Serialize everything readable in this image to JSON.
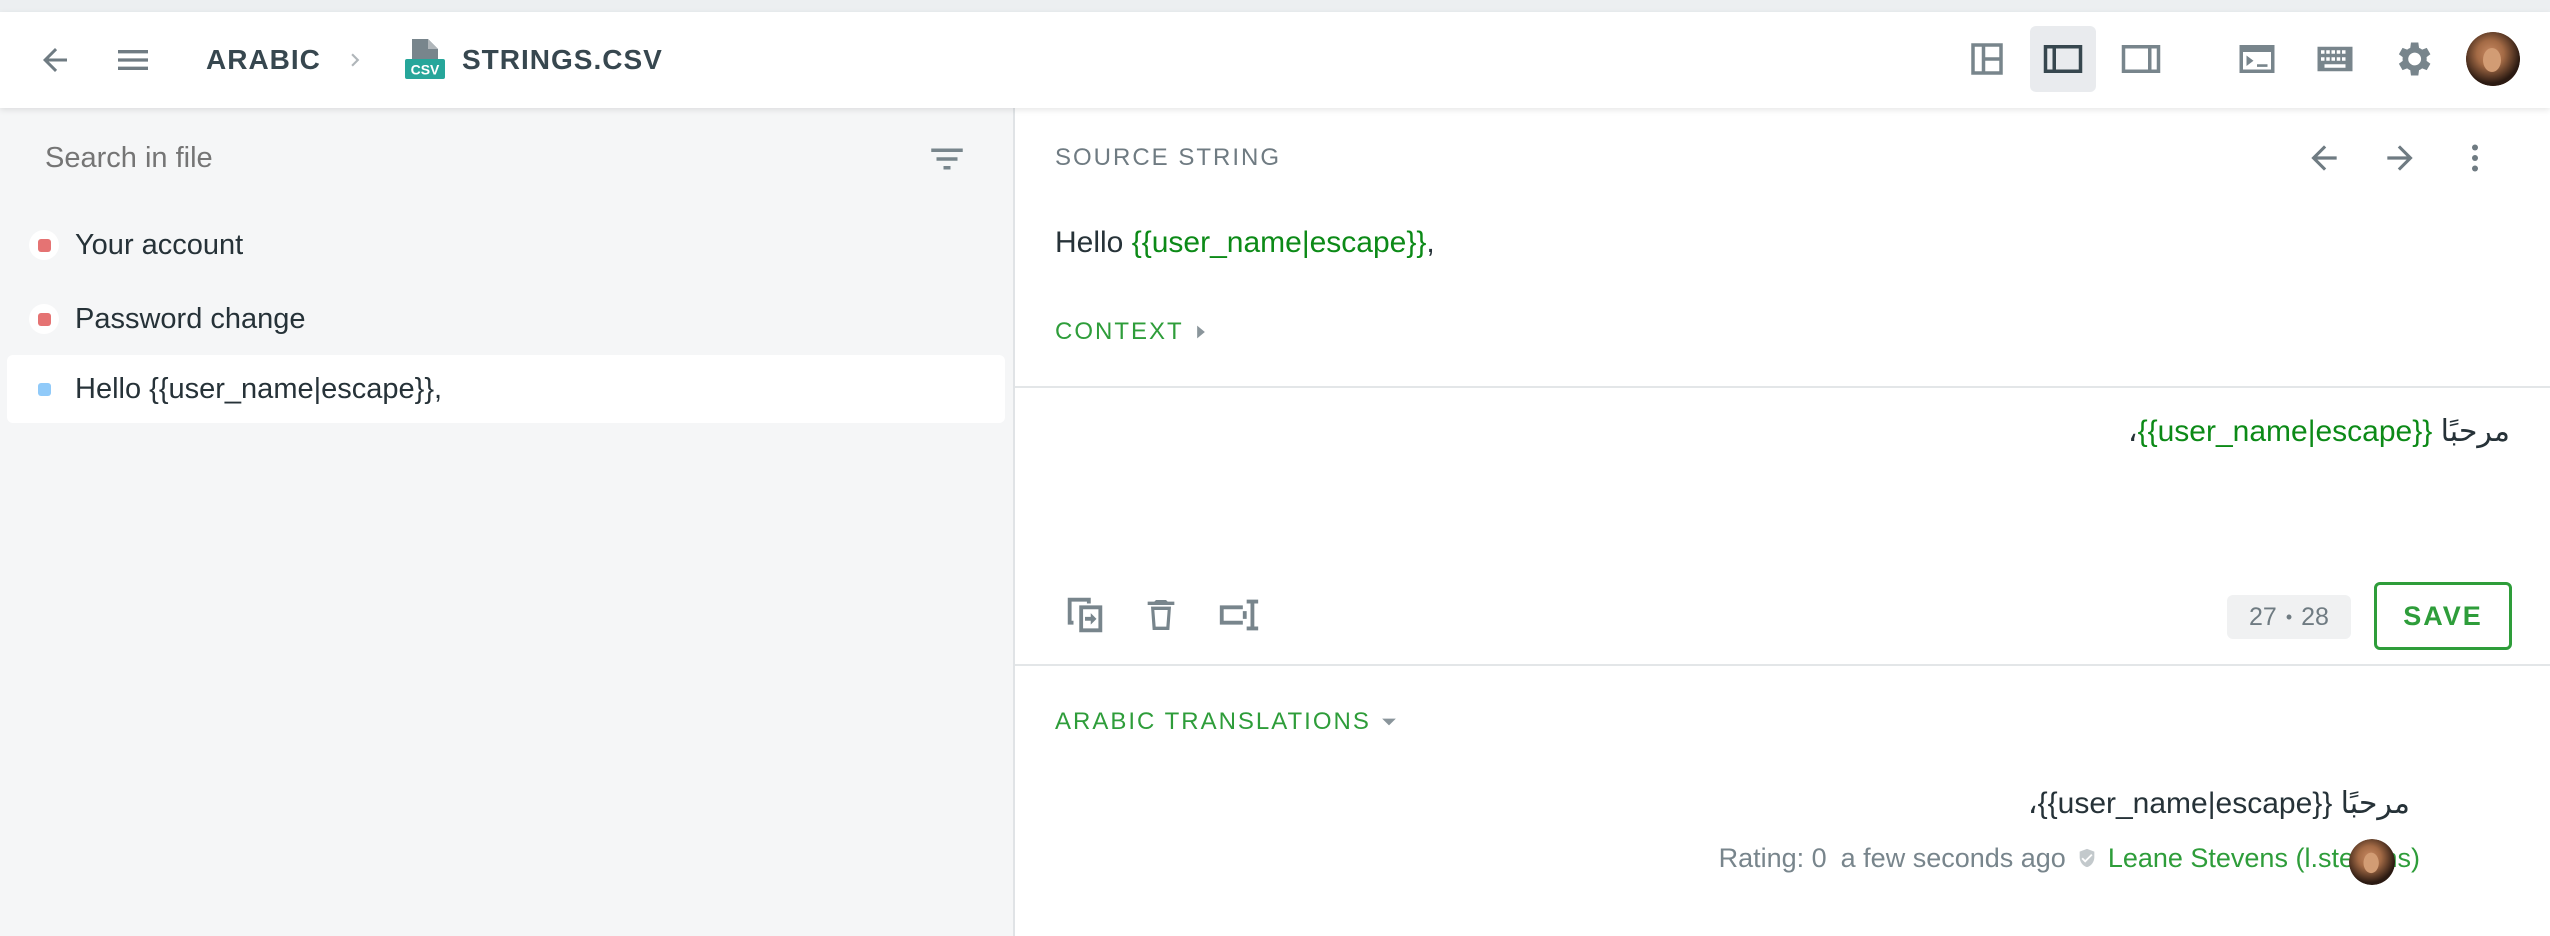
{
  "header": {
    "language": "ARABIC",
    "file_name": "STRINGS.CSV",
    "file_icon_label": "CSV"
  },
  "sidebar": {
    "search_placeholder": "Search in file",
    "items": [
      {
        "label": "Your account",
        "status_color": "#e57373"
      },
      {
        "label": "Password change",
        "status_color": "#e57373"
      },
      {
        "label": "Hello {{user_name|escape}},",
        "status_color": "#90caf9"
      }
    ]
  },
  "source": {
    "section_label": "SOURCE STRING",
    "text_prefix": "Hello ",
    "placeholder": "{{user_name|escape}}",
    "text_suffix": ",",
    "context_label": "CONTEXT"
  },
  "editor": {
    "word": "مرحبًا",
    "placeholder": "{{user_name|escape}}",
    "suffix": "،",
    "count_left": "27",
    "count_separator": "•",
    "count_right": "28",
    "save_label": "SAVE"
  },
  "history": {
    "section_label": "ARABIC TRANSLATIONS",
    "text": "مرحبًا {{user_name|escape}}،",
    "rating": "Rating: 0",
    "time": "a few seconds ago",
    "author": "Leane Stevens (l.stevens)"
  },
  "colors": {
    "accent": "#2e9d3a",
    "placeholder_green": "#0c8a17",
    "status_red": "#e57373",
    "status_blue": "#90caf9"
  },
  "icons": [
    "back-arrow-icon",
    "menu-icon",
    "chevron-right-icon",
    "csv-file-icon",
    "layout-icon",
    "sidebar-left-icon",
    "sidebar-right-icon",
    "terminal-icon",
    "keyboard-icon",
    "gear-icon",
    "filter-icon",
    "arrow-left-icon",
    "arrow-right-icon",
    "more-vertical-icon",
    "caret-right-icon",
    "copy-source-icon",
    "trash-icon",
    "rtl-text-icon",
    "caret-down-icon",
    "shield-check-icon"
  ]
}
